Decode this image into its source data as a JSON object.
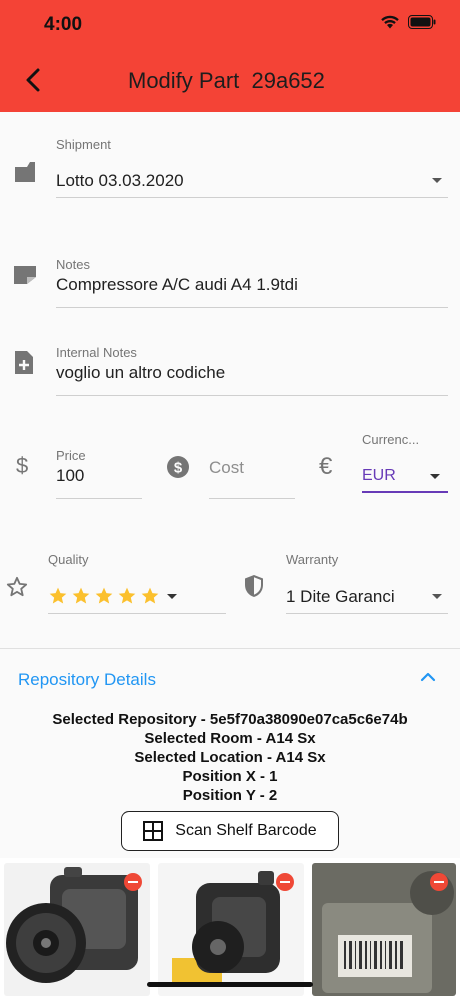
{
  "status_bar": {
    "time": "4:00"
  },
  "header": {
    "title": "Modify Part  29a652"
  },
  "shipment": {
    "label": "Shipment",
    "value": "Lotto 03.03.2020"
  },
  "notes": {
    "label": "Notes",
    "value": "Compressore A/C audi A4 1.9tdi"
  },
  "internal_notes": {
    "label": "Internal Notes",
    "value": "voglio un altro codiche"
  },
  "price": {
    "label": "Price",
    "value": "100"
  },
  "cost": {
    "placeholder": "Cost"
  },
  "currency": {
    "label": "Currenc...",
    "value": "EUR"
  },
  "quality": {
    "label": "Quality",
    "stars": 5
  },
  "warranty": {
    "label": "Warranty",
    "value": "1 Dite Garanci"
  },
  "repository": {
    "title": "Repository Details",
    "lines": [
      "Selected Repository - 5e5f70a38090e07ca5c6e74b",
      "Selected Room - A14 Sx",
      "Selected Location - A14 Sx",
      "Position X - 1",
      "Position Y - 2"
    ],
    "scan_button": "Scan Shelf Barcode"
  },
  "colors": {
    "appbar": "#f44336",
    "accent": "#2196f3",
    "focus": "#673ab7",
    "star": "#fbc02d"
  }
}
